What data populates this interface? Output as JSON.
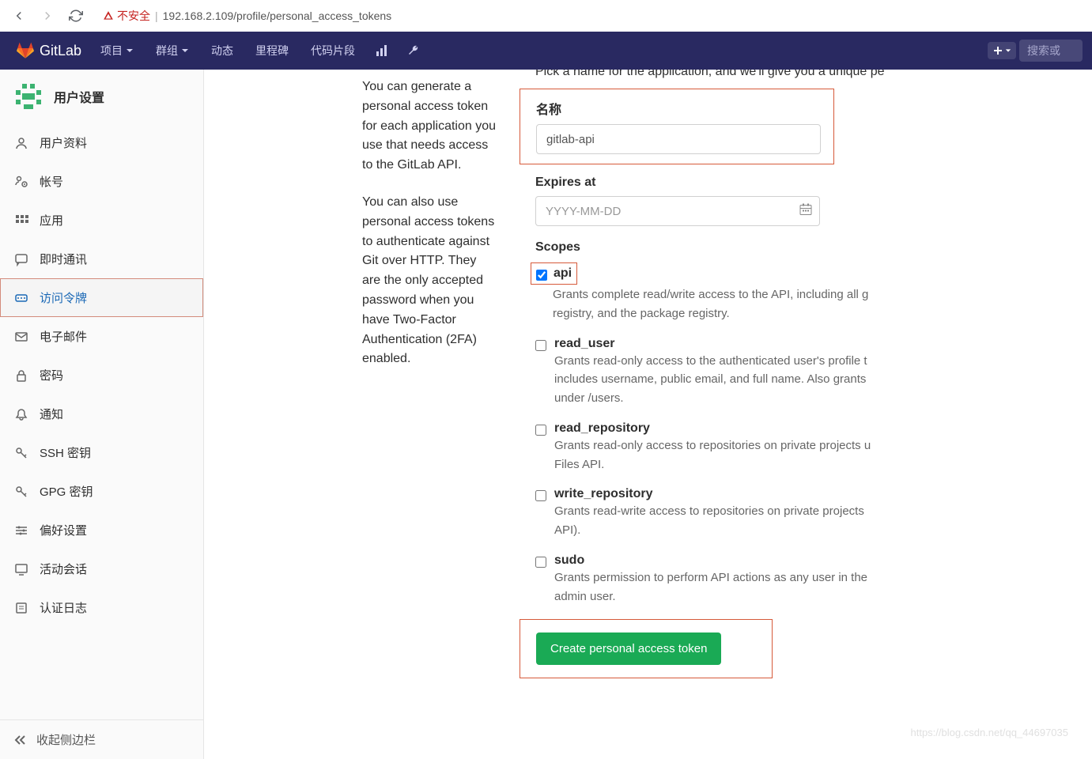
{
  "browser": {
    "insecure_label": "不安全",
    "url": "192.168.2.109/profile/personal_access_tokens"
  },
  "navbar": {
    "brand": "GitLab",
    "items": [
      "项目",
      "群组",
      "动态",
      "里程碑",
      "代码片段"
    ],
    "search_placeholder": "搜索或"
  },
  "sidebar": {
    "title": "用户设置",
    "items": [
      {
        "label": "用户资料",
        "icon": "user"
      },
      {
        "label": "帐号",
        "icon": "cog-user"
      },
      {
        "label": "应用",
        "icon": "apps"
      },
      {
        "label": "即时通讯",
        "icon": "chat"
      },
      {
        "label": "访问令牌",
        "icon": "token",
        "active": true
      },
      {
        "label": "电子邮件",
        "icon": "mail"
      },
      {
        "label": "密码",
        "icon": "lock"
      },
      {
        "label": "通知",
        "icon": "bell"
      },
      {
        "label": "SSH 密钥",
        "icon": "key"
      },
      {
        "label": "GPG 密钥",
        "icon": "key"
      },
      {
        "label": "偏好设置",
        "icon": "sliders"
      },
      {
        "label": "活动会话",
        "icon": "monitor"
      },
      {
        "label": "认证日志",
        "icon": "list"
      }
    ],
    "collapse": "收起侧边栏"
  },
  "description": {
    "p1": "You can generate a personal access token for each application you use that needs access to the GitLab API.",
    "p2": "You can also use personal access tokens to authenticate against Git over HTTP. They are the only accepted password when you have Two-Factor Authentication (2FA) enabled."
  },
  "form": {
    "hint": "Pick a name for the application, and we'll give you a unique pe",
    "name_label": "名称",
    "name_value": "gitlab-api",
    "expires_label": "Expires at",
    "expires_placeholder": "YYYY-MM-DD",
    "scopes_label": "Scopes",
    "scopes": [
      {
        "name": "api",
        "checked": true,
        "desc": "Grants complete read/write access to the API, including all g",
        "desc2": "registry, and the package registry."
      },
      {
        "name": "read_user",
        "checked": false,
        "desc": "Grants read-only access to the authenticated user's profile t",
        "desc2": "includes username, public email, and full name. Also grants ",
        "desc3": "under /users."
      },
      {
        "name": "read_repository",
        "checked": false,
        "desc": "Grants read-only access to repositories on private projects u",
        "desc2": "Files API."
      },
      {
        "name": "write_repository",
        "checked": false,
        "desc": "Grants read-write access to repositories on private projects ",
        "desc2": "API)."
      },
      {
        "name": "sudo",
        "checked": false,
        "desc": "Grants permission to perform API actions as any user in the ",
        "desc2": "admin user."
      }
    ],
    "submit": "Create personal access token"
  },
  "watermark": "https://blog.csdn.net/qq_44697035"
}
